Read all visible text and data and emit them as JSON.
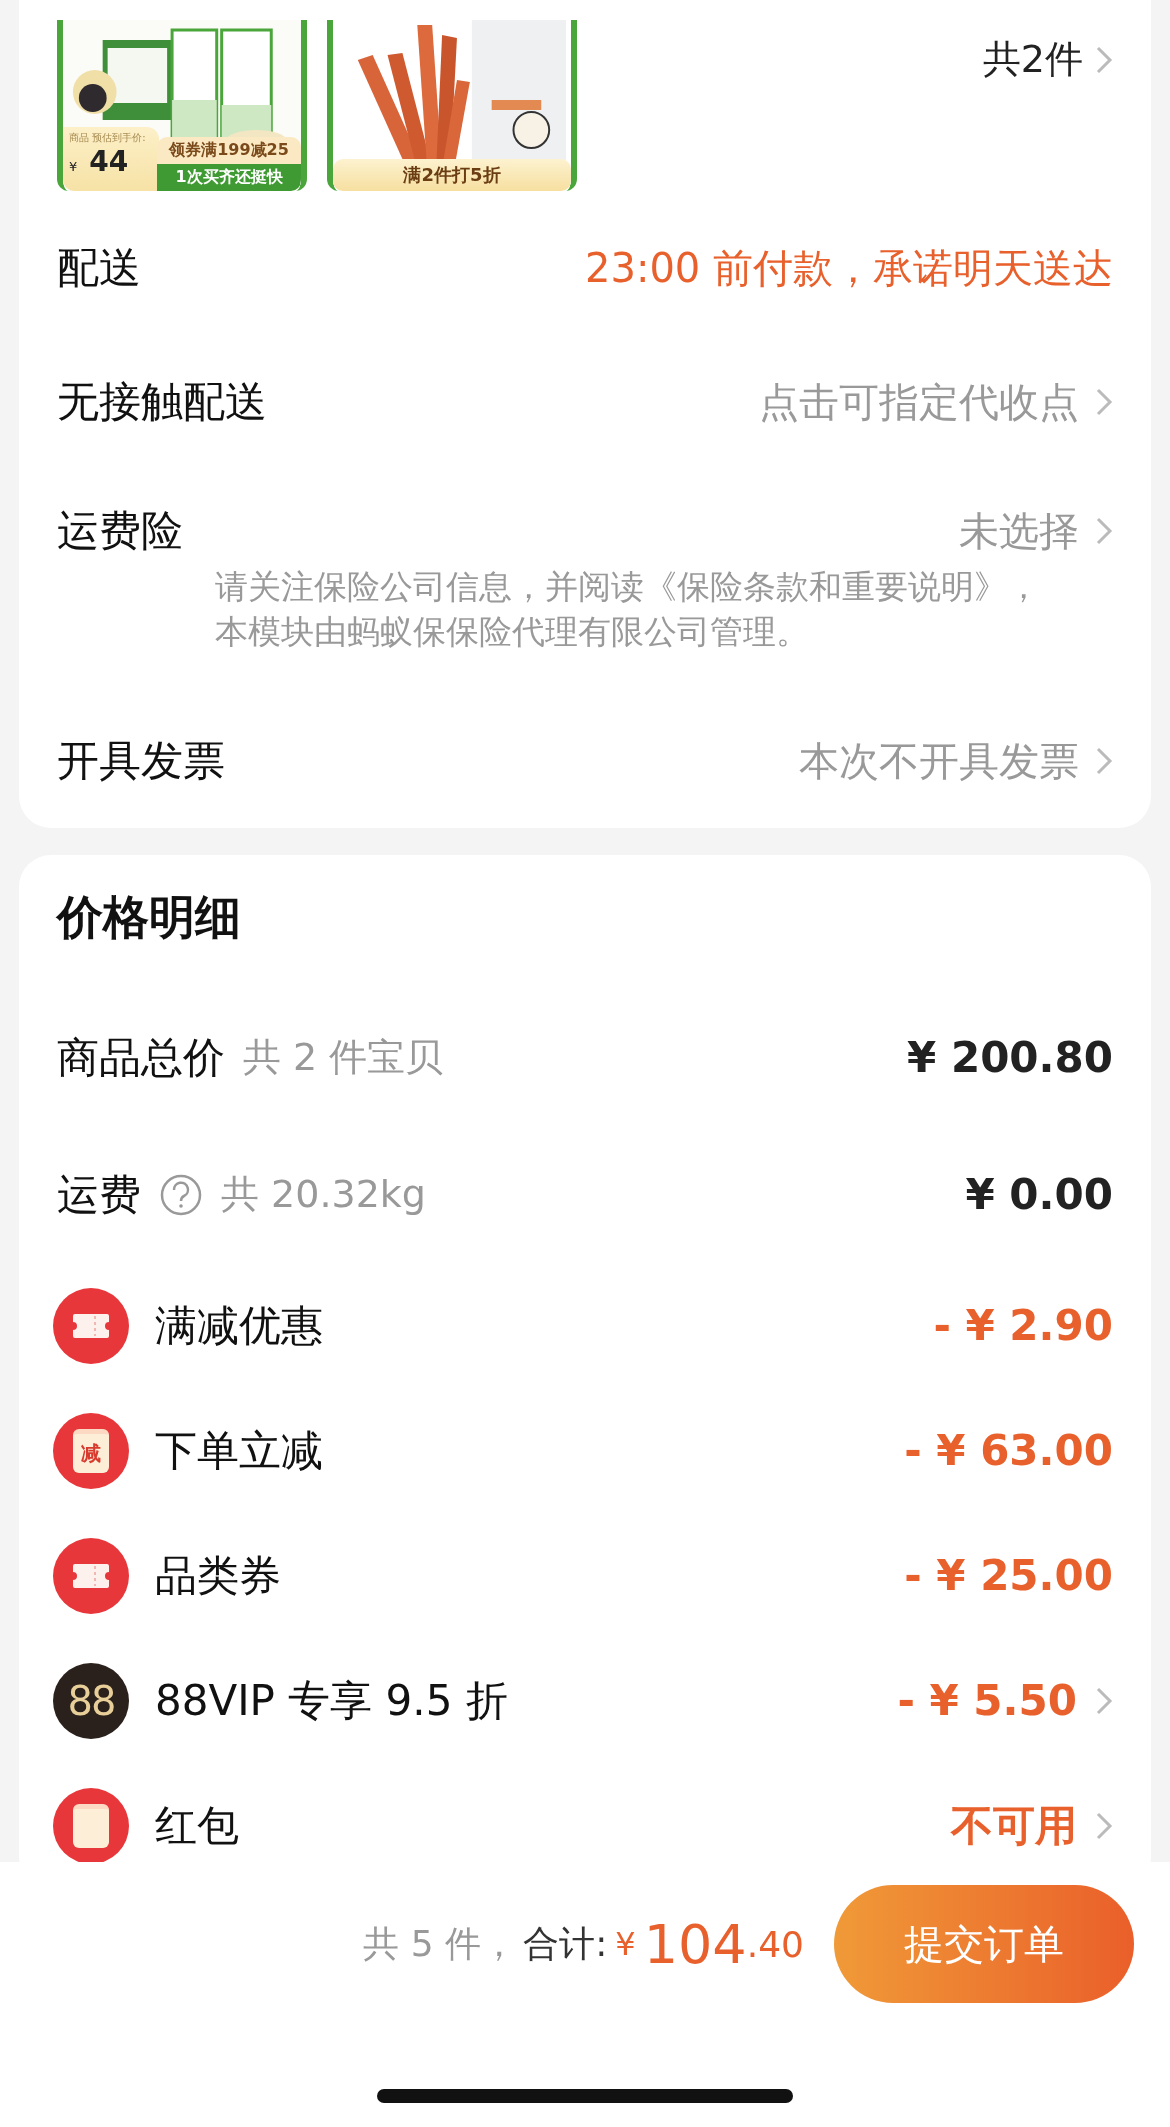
{
  "order_items": {
    "products": [
      {
        "price_tag": {
          "label": "商品 预估到手价:",
          "currency": "¥",
          "price": "44"
        },
        "badges": [
          "领券满199减25",
          "1次买齐还挺快"
        ]
      },
      {
        "badges": [
          "满2件打5折"
        ]
      }
    ],
    "count": "共2件",
    "chevron": true
  },
  "service_rows": [
    {
      "label": "配送",
      "value": "23:00 前付款，承诺明天送达",
      "highlight": true,
      "chevron": false
    },
    {
      "label": "无接触配送",
      "value": "点击可指定代收点",
      "highlight": false,
      "chevron": true
    },
    {
      "label": "运费险",
      "value": "未选择",
      "highlight": false,
      "chevron": true,
      "note": "请关注保险公司信息，并阅读《保险条款和重要说明》，本模块由蚂蚁保保险代理有限公司管理。"
    },
    {
      "label": "开具发票",
      "value": "本次不开具发票",
      "highlight": false,
      "chevron": true
    }
  ],
  "price_detail": {
    "title": "价格明细",
    "rows": [
      {
        "kind": "plain",
        "label": "商品总价",
        "sub": "共 2 件宝贝",
        "help": false,
        "amount": "¥ 200.80",
        "chevron": false
      },
      {
        "kind": "plain",
        "label": "运费",
        "sub": "共 20.32kg",
        "help": true,
        "amount": "¥ 0.00",
        "chevron": false
      },
      {
        "kind": "coupon",
        "label": "满减优惠",
        "amount": "- ¥ 2.90",
        "chevron": false
      },
      {
        "kind": "envelope",
        "icon_text": "减",
        "label": "下单立减",
        "amount": "- ¥ 63.00",
        "chevron": false
      },
      {
        "kind": "coupon",
        "label": "品类券",
        "amount": "- ¥ 25.00",
        "chevron": false
      },
      {
        "kind": "vip",
        "icon_text": "88",
        "label": "88VIP 专享 9.5 折",
        "amount": "- ¥ 5.50",
        "chevron": true
      },
      {
        "kind": "envelope",
        "label": "红包",
        "amount": "不可用",
        "chevron": true
      }
    ]
  },
  "footer": {
    "count": "共 5 件，",
    "total_label": "合计:",
    "currency": "¥",
    "amount_int": "104",
    "amount_dec": ".40",
    "submit": "提交订单"
  }
}
